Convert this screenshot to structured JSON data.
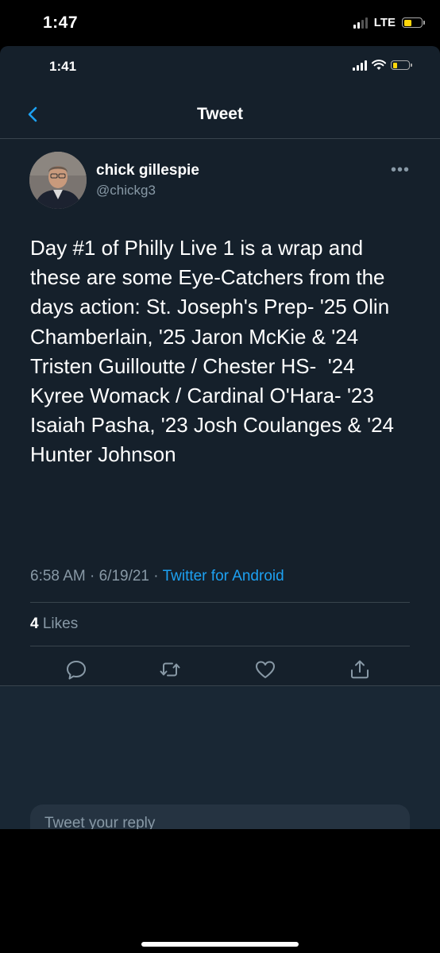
{
  "outer_status": {
    "time": "1:47",
    "network": "LTE"
  },
  "inner_status": {
    "time": "1:41"
  },
  "nav": {
    "title": "Tweet"
  },
  "tweet": {
    "author_name": "chick gillespie",
    "author_handle": "@chickg3",
    "more_glyph": "•••",
    "text": "Day #1 of Philly Live 1 is a wrap and these are some Eye-Catchers from the days action: St. Joseph's Prep- '25 Olin Chamberlain, '25 Jaron McKie & '24 Tristen Guilloutte / Chester HS-  '24 Kyree Womack / Cardinal O'Hara- '23 Isaiah Pasha, '23 Josh Coulanges & '24 Hunter Johnson",
    "time": "6:58 AM",
    "date": "6/19/21",
    "source": "Twitter for Android",
    "likes_count": "4",
    "likes_label": "Likes"
  },
  "reply": {
    "placeholder": "Tweet your reply"
  },
  "icons": {
    "back": "chevron-left-icon",
    "reply": "reply-icon",
    "retweet": "retweet-icon",
    "like": "heart-icon",
    "share": "share-icon"
  },
  "colors": {
    "background": "#15202b",
    "accent": "#1da1f2",
    "muted": "#8899a6",
    "divider": "#38444d"
  }
}
